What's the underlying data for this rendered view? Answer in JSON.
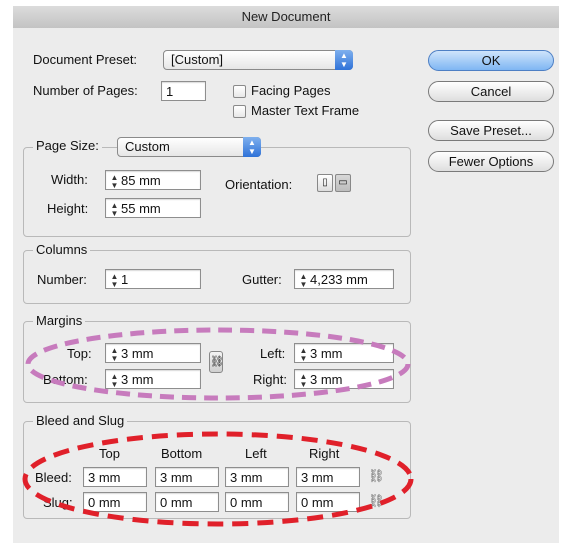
{
  "title": "New Document",
  "preset": {
    "label": "Document Preset:",
    "value": "[Custom]"
  },
  "pages": {
    "label": "Number of Pages:",
    "value": "1"
  },
  "checkboxes": {
    "facing": "Facing Pages",
    "master": "Master Text Frame"
  },
  "buttons": {
    "ok": "OK",
    "cancel": "Cancel",
    "save_preset": "Save Preset...",
    "fewer": "Fewer Options"
  },
  "page_size": {
    "label": "Page Size:",
    "value": "Custom",
    "width_label": "Width:",
    "width": "85 mm",
    "height_label": "Height:",
    "height": "55 mm",
    "orientation_label": "Orientation:"
  },
  "columns": {
    "title": "Columns",
    "number_label": "Number:",
    "number": "1",
    "gutter_label": "Gutter:",
    "gutter": "4,233 mm"
  },
  "margins": {
    "title": "Margins",
    "top_label": "Top:",
    "top": "3 mm",
    "bottom_label": "Bottom:",
    "bottom": "3 mm",
    "left_label": "Left:",
    "left": "3 mm",
    "right_label": "Right:",
    "right": "3 mm"
  },
  "bleed_slug": {
    "title": "Bleed and Slug",
    "headers": [
      "Top",
      "Bottom",
      "Left",
      "Right"
    ],
    "bleed_label": "Bleed:",
    "bleed": [
      "3 mm",
      "3 mm",
      "3 mm",
      "3 mm"
    ],
    "slug_label": "Slug:",
    "slug": [
      "0 mm",
      "0 mm",
      "0 mm",
      "0 mm"
    ]
  },
  "colors": {
    "margins_highlight": "#c77bbd",
    "bleed_highlight": "#e0202a"
  }
}
